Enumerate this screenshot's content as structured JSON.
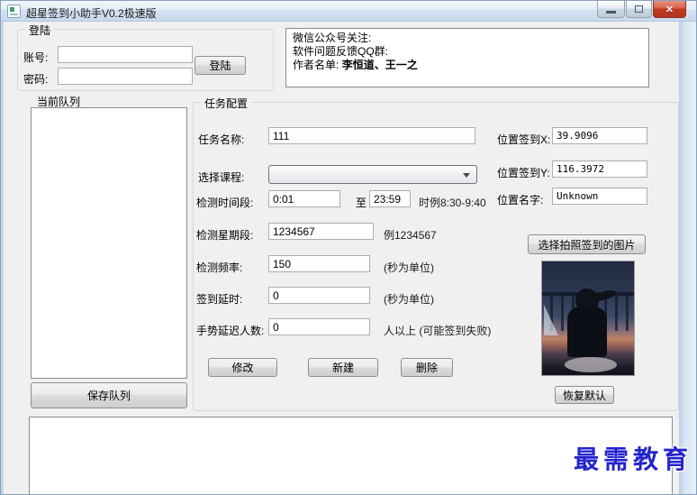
{
  "window": {
    "title": "超星签到小助手V0.2极速版",
    "controls": {
      "minimize_icon": "minimize-bar",
      "maximize_icon": "maximize-box",
      "close_icon": "✕"
    }
  },
  "login": {
    "group_label": "登陆",
    "account_label": "账号:",
    "account_value": "",
    "password_label": "密码:",
    "password_value": "",
    "login_button": "登陆"
  },
  "info_box": {
    "line1": "微信公众号关注:",
    "line2": "软件问题反馈QQ群:",
    "line3_label": "作者名单:",
    "line3_value": "李恒道、王一之"
  },
  "queue": {
    "label": "当前队列",
    "save_button": "保存队列"
  },
  "task_config": {
    "group_label": "任务配置",
    "task_name": {
      "label": "任务名称:",
      "value": "111"
    },
    "course": {
      "label": "选择课程:",
      "value": ""
    },
    "time_range": {
      "label": "检测时间段:",
      "from": "0:01",
      "to_label": "至",
      "to": "23:59",
      "hint": "时例8:30-9:40"
    },
    "week_range": {
      "label": "检测星期段:",
      "value": "1234567",
      "hint": "例1234567"
    },
    "frequency": {
      "label": "检测频率:",
      "value": "150",
      "hint": "(秒为单位)"
    },
    "sign_delay": {
      "label": "签到延时:",
      "value": "0",
      "hint": "(秒为单位)"
    },
    "gesture_delay": {
      "label": "手势延迟人数:",
      "value": "0",
      "hint": "人以上 (可能签到失败)"
    },
    "buttons": {
      "modify": "修改",
      "create": "新建",
      "delete": "删除"
    },
    "location_x": {
      "label": "位置签到X:",
      "value": "39.9096"
    },
    "location_y": {
      "label": "位置签到Y:",
      "value": "116.3972"
    },
    "location_name": {
      "label": "位置名字:",
      "value": "Unknown"
    },
    "photo_button": "选择拍照签到的图片",
    "restore_button": "恢复默认"
  },
  "log": {
    "content": ""
  },
  "watermark": "最需教育",
  "colors": {
    "close_button_red": "#c23a21",
    "watermark_blue": "#2424cd",
    "client_background": "#f0f0f0",
    "glass_border_blue": "#c2d6ec"
  }
}
